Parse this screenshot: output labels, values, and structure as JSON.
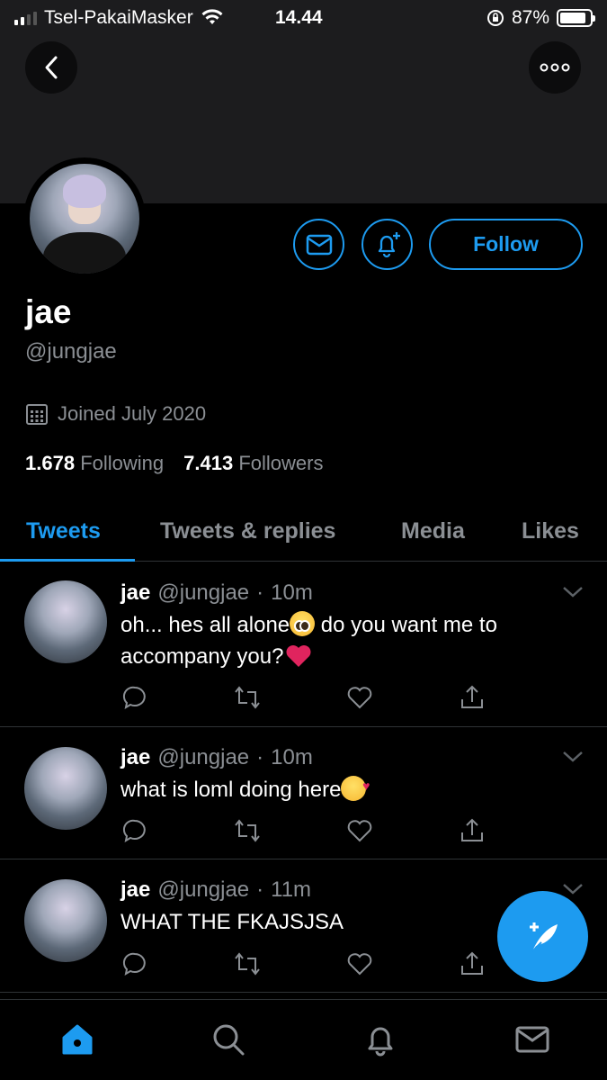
{
  "status_bar": {
    "carrier": "Tsel-PakaiMasker",
    "time": "14.44",
    "battery_percent_label": "87%",
    "battery_level": 0.87,
    "icons": [
      "signal-icon",
      "wifi-icon",
      "orientation-lock-icon",
      "battery-icon"
    ]
  },
  "header": {
    "back_icon": "chevron-left-icon",
    "more_icon": "more-horizontal-icon"
  },
  "profile": {
    "name": "jae",
    "handle": "@jungjae",
    "joined": "Joined July 2020",
    "following_count": "1.678",
    "following_label": "Following",
    "followers_count": "7.413",
    "followers_label": "Followers",
    "follow_button_label": "Follow",
    "message_icon": "mail-icon",
    "notify_icon": "bell-plus-icon",
    "calendar_icon": "calendar-icon"
  },
  "tabs": [
    {
      "label": "Tweets",
      "active": true
    },
    {
      "label": "Tweets & replies",
      "active": false
    },
    {
      "label": "Media",
      "active": false
    },
    {
      "label": "Likes",
      "active": false
    }
  ],
  "tweets": [
    {
      "name": "jae",
      "handle": "@jungjae",
      "time": "10m",
      "text_before": "oh... hes all alone",
      "text_after": " do you want me to accompany you?",
      "emoji_1": "pleading-face",
      "emoji_2": "red-heart"
    },
    {
      "name": "jae",
      "handle": "@jungjae",
      "time": "10m",
      "text_before": "what is loml doing here",
      "emoji_1": "smiling-face-with-hearts"
    },
    {
      "name": "jae",
      "handle": "@jungjae",
      "time": "11m",
      "text_before": "WHAT THE FKAJSJSA"
    }
  ],
  "tweet_actions": [
    "reply-icon",
    "retweet-icon",
    "like-icon",
    "share-icon"
  ],
  "fab_icon": "compose-tweet-icon",
  "bottom_nav": [
    "home-icon",
    "search-icon",
    "notifications-icon",
    "messages-icon"
  ],
  "colors": {
    "accent": "#1d9bf0",
    "background": "#000000",
    "banner": "#1c1c1e",
    "secondary_text": "#8b8f94",
    "divider": "#2f3336"
  }
}
